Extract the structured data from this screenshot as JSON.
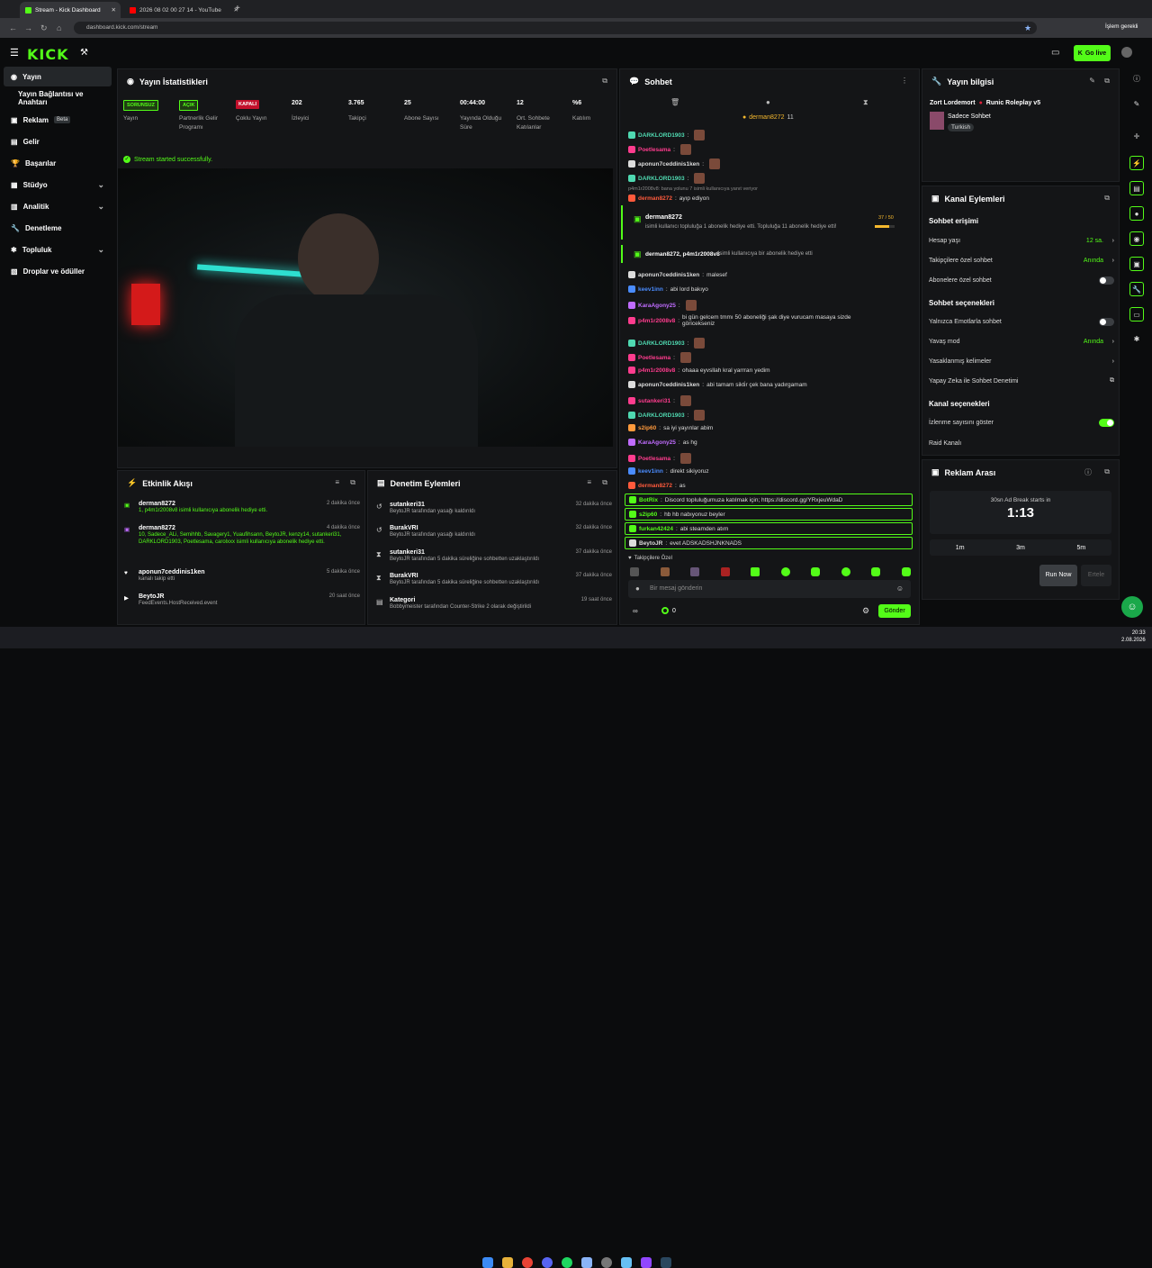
{
  "browser": {
    "tabs": [
      {
        "title": "Stream - Kick Dashboard"
      },
      {
        "title": "2026 08 02 00 27 14 - YouTube"
      }
    ],
    "url": "dashboard.kick.com/stream",
    "profile_label": "İşlem gerekli"
  },
  "topnav": {
    "logo": "KICK",
    "go_live": "Go live"
  },
  "sidebar": {
    "items": [
      {
        "label": "Yayın"
      },
      {
        "label": "Yayın Bağlantısı ve Anahtarı"
      },
      {
        "label": "Reklam",
        "badge": "Beta"
      },
      {
        "label": "Gelir"
      },
      {
        "label": "Başarılar"
      },
      {
        "label": "Stüdyo"
      },
      {
        "label": "Analitik"
      },
      {
        "label": "Denetleme"
      },
      {
        "label": "Topluluk"
      },
      {
        "label": "Droplar ve ödüller"
      }
    ]
  },
  "stats": {
    "title": "Yayın İstatistikleri",
    "items": [
      {
        "badge": "SORUNSUZ",
        "label": "Yayın",
        "color": "#53fc18"
      },
      {
        "badge": "AÇIK",
        "label": "Partnerlik Gelir Programı",
        "color": "#53fc18"
      },
      {
        "badge": "KAPALI",
        "label": "Çoklu Yayın",
        "color": "#e0203a"
      },
      {
        "value": "202",
        "label": "İzleyici"
      },
      {
        "value": "3.765",
        "label": "Takipçi"
      },
      {
        "value": "25",
        "label": "Abone Sayısı"
      },
      {
        "value": "00:44:00",
        "label": "Yayında Olduğu Süre"
      },
      {
        "value": "12",
        "label": "Ort. Sohbete Katılanlar"
      },
      {
        "value": "%6",
        "label": "Katılım"
      }
    ],
    "success": "Stream started successfully."
  },
  "activity": {
    "title": "Etkinlik Akışı",
    "events": [
      {
        "name": "derman8272",
        "time": "2 dakika önce",
        "desc": "1, p4m1r2008v8 isimli kullanıcıya abonelik hediye etti."
      },
      {
        "name": "derman8272",
        "time": "4 dakika önce",
        "desc": "10, Sadece_ALi, Semihhb, Savagery1, Yuaufihsann, BeytoJR, kenzy14, sutankeri31, DARKLORD1903, Poetlesama, carolxxx isimli kullanıcıya abonelik hediye etti."
      },
      {
        "name": "aponun7ceddinis1ken",
        "time": "5 dakika önce",
        "desc": "kanalı takip etti"
      },
      {
        "name": "BeytoJR",
        "time": "20 saat önce",
        "desc": "FeedEvents.HostReceived.event"
      }
    ]
  },
  "moderation": {
    "title": "Denetim Eylemleri",
    "items": [
      {
        "name": "sutankeri31",
        "time": "32 dakika önce",
        "desc": "BeytoJR tarafından yasağı kaldırıldı"
      },
      {
        "name": "BurakVRI",
        "time": "32 dakika önce",
        "desc": "BeytoJR tarafından yasağı kaldırıldı"
      },
      {
        "name": "sutankeri31",
        "time": "37 dakika önce",
        "desc": "BeytoJR tarafından 5 dakika süreliğine sohbetten uzaklaştırıldı"
      },
      {
        "name": "BurakVRI",
        "time": "37 dakika önce",
        "desc": "BeytoJR tarafından 5 dakika süreliğine sohbetten uzaklaştırıldı"
      },
      {
        "name": "Kategori",
        "time": "19 saat önce",
        "desc": "Bobbymeister tarafından Counter-Strike 2 olarak değiştirildi"
      }
    ]
  },
  "chat": {
    "title": "Sohbet",
    "pinned": "derman8272",
    "pinned_count": "11",
    "reply": "p4m1r2008v8: bana yolunu 7 isimli kullanıcıya yanıt veriyor",
    "gift1": {
      "name": "derman8272",
      "desc": "isimli kullanıcı topluluğa 1 abonelik hediye etti. Topluluğa 11 abonelik hediye etti!",
      "progress": "37 / 50"
    },
    "gift2": {
      "text": "derman8272, p4m1r2008v8",
      "desc": "isimli kullanıcıya bir abonelik hediye etti"
    },
    "messages": [
      {
        "user": "DARKLORD1903",
        "msg": "",
        "color": "#4fd9b1"
      },
      {
        "user": "Poetlesama",
        "msg": "",
        "color": "#ff3c8e"
      },
      {
        "user": "aponun7ceddinis1ken",
        "msg": "",
        "color": "#dddddd"
      },
      {
        "user": "DARKLORD1903",
        "msg": "",
        "color": "#4fd9b1"
      },
      {
        "user": "derman8272",
        "msg": "ayıp ediyon",
        "color": "#ff5a3c"
      },
      {
        "user": "aponun7ceddinis1ken",
        "msg": "malesef",
        "color": "#dddddd"
      },
      {
        "user": "keev1inn",
        "msg": "abi lord bakıyo",
        "color": "#4a8cff"
      },
      {
        "user": "KaraAgony25",
        "msg": "",
        "color": "#c06cff"
      },
      {
        "user": "p4m1r2008v8",
        "msg": "bi gün gelcem tmmı 50 aboneliği şak diye vurucam masaya sizde göricekseniz",
        "color": "#ff3c8e"
      },
      {
        "user": "DARKLORD1903",
        "msg": "",
        "color": "#4fd9b1"
      },
      {
        "user": "Poetlesama",
        "msg": "",
        "color": "#ff3c8e"
      },
      {
        "user": "p4m1r2008v8",
        "msg": "ohaaa eyvsllah kral yarrrarı yedim",
        "color": "#ff3c8e"
      },
      {
        "user": "aponun7ceddinis1ken",
        "msg": "abi tamam sikti̇r çek bana yadırgamam",
        "color": "#dddddd"
      },
      {
        "user": "sutankeri31",
        "msg": "",
        "color": "#ff3c8e"
      },
      {
        "user": "DARKLORD1903",
        "msg": "",
        "color": "#4fd9b1"
      },
      {
        "user": "s2ip60",
        "msg": "sa iyi yayınlar abim",
        "color": "#ff9a3c"
      },
      {
        "user": "KaraAgony25",
        "msg": "as hg",
        "color": "#c06cff"
      },
      {
        "user": "Poetlesama",
        "msg": "",
        "color": "#ff3c8e"
      },
      {
        "user": "keev1inn",
        "msg": "direkt sikiyoruz",
        "color": "#4a8cff"
      },
      {
        "user": "derman8272",
        "msg": "as",
        "color": "#ff5a3c"
      },
      {
        "user": "BotRix",
        "msg": "Discord topluluğumuza katılmak için; https://discord.gg/YRxjeuWdaD",
        "color": "#53fc18"
      },
      {
        "user": "s2ip60",
        "msg": "hb hb nabıyonuz beyler",
        "color": "#53fc18"
      },
      {
        "user": "furkan42424",
        "msg": "abi steamden atım",
        "color": "#53fc18"
      },
      {
        "user": "BeytoJR",
        "msg": "evet ADSKADSHJNKNADS",
        "color": "#dddddd"
      }
    ],
    "followers_only": "Takipçilere Özel",
    "input_placeholder": "Bir mesaj gönderin",
    "count": "0",
    "send": "Gönder"
  },
  "stream_info": {
    "title": "Yayın bilgisi",
    "streamer": "Zort Lordemort",
    "category": "Runic Roleplay v5",
    "tag": "Sadece Sohbet",
    "lang": "Turkish"
  },
  "channel_actions": {
    "title": "Kanal Eylemleri",
    "chat_access": "Sohbet erişimi",
    "account_age": "Hesap yaşı",
    "account_age_val": "12 sa.",
    "followers_only": "Takipçilere özel sohbet",
    "followers_only_val": "Anında",
    "subs_only": "Abonelere özel sohbet",
    "chat_options": "Sohbet seçenekleri",
    "emotes_only": "Yalnızca Emotlarla sohbet",
    "slow_mode": "Yavaş mod",
    "slow_mode_val": "Anında",
    "banned_words": "Yasaklanmış kelimeler",
    "ai_mod": "Yapay Zeka ile Sohbet Denetimi",
    "channel_options": "Kanal seçenekleri",
    "show_viewers": "İzlenme sayısını göster",
    "raid": "Raid Kanalı"
  },
  "ad_break": {
    "title": "Reklam Arası",
    "caption": "30sn Ad Break starts in",
    "countdown": "1:13",
    "durations": [
      "1m",
      "3m",
      "5m"
    ],
    "run_now": "Run Now",
    "cancel": "Ertele"
  },
  "taskbar": {
    "time": "20:33",
    "date": "2.08.2026"
  }
}
